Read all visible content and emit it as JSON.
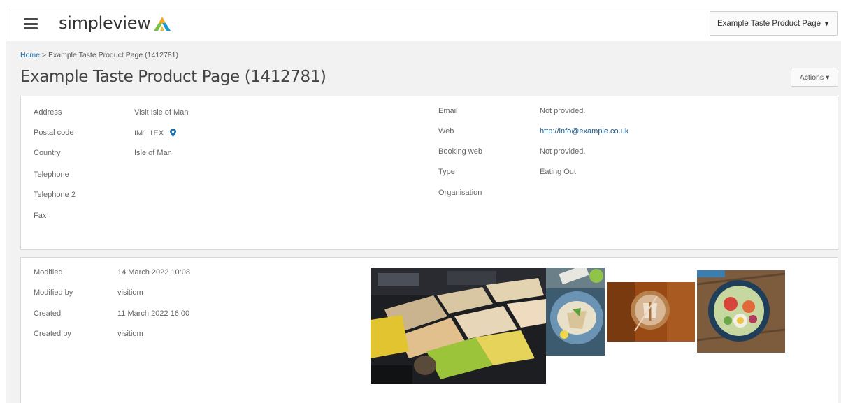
{
  "header": {
    "menu_icon": "hamburger-menu-icon",
    "logo_text": "simpleview",
    "logo_icon": "simpleview-logo-mark",
    "product_selector": {
      "label": "Example Taste Product Page",
      "arrow": "▼"
    }
  },
  "breadcrumb": {
    "home": "Home",
    "separator": ">",
    "current": "Example Taste Product Page (1412781)"
  },
  "page": {
    "title": "Example Taste Product Page (1412781)",
    "actions_label": "Actions ▾"
  },
  "contact": {
    "left": [
      {
        "label": "Address",
        "value": "Visit Isle of Man"
      },
      {
        "label": "Postal code",
        "value": "IM1 1EX"
      },
      {
        "label": "Country",
        "value": "Isle of Man"
      },
      {
        "label": "Telephone",
        "value": ""
      },
      {
        "label": "Telephone 2",
        "value": ""
      },
      {
        "label": "Fax",
        "value": ""
      }
    ],
    "right": [
      {
        "label": "Email",
        "value": "Not provided."
      },
      {
        "label": "Web",
        "value": "http://info@example.co.uk"
      },
      {
        "label": "Booking web",
        "value": "Not provided."
      },
      {
        "label": "Type",
        "value": "Eating Out"
      },
      {
        "label": "Organisation",
        "value": ""
      }
    ],
    "map_pin_icon": "map-pin-icon"
  },
  "meta": [
    {
      "label": "Modified",
      "value": "14 March 2022 10:08"
    },
    {
      "label": "Modified by",
      "value": "visitiom"
    },
    {
      "label": "Created",
      "value": "11 March 2022 16:00"
    },
    {
      "label": "Created by",
      "value": "visitiom"
    }
  ],
  "gallery": [
    {
      "alt": "buffet-trays-photo"
    },
    {
      "alt": "plated-dish-photo"
    },
    {
      "alt": "latte-art-photo"
    },
    {
      "alt": "bowl-dish-photo"
    }
  ],
  "colors": {
    "link": "#1a6fb0",
    "pin": "#1a6fb0",
    "logo_orange": "#f5a623",
    "logo_green": "#7bbf3f",
    "logo_blue": "#1c9ad6"
  }
}
